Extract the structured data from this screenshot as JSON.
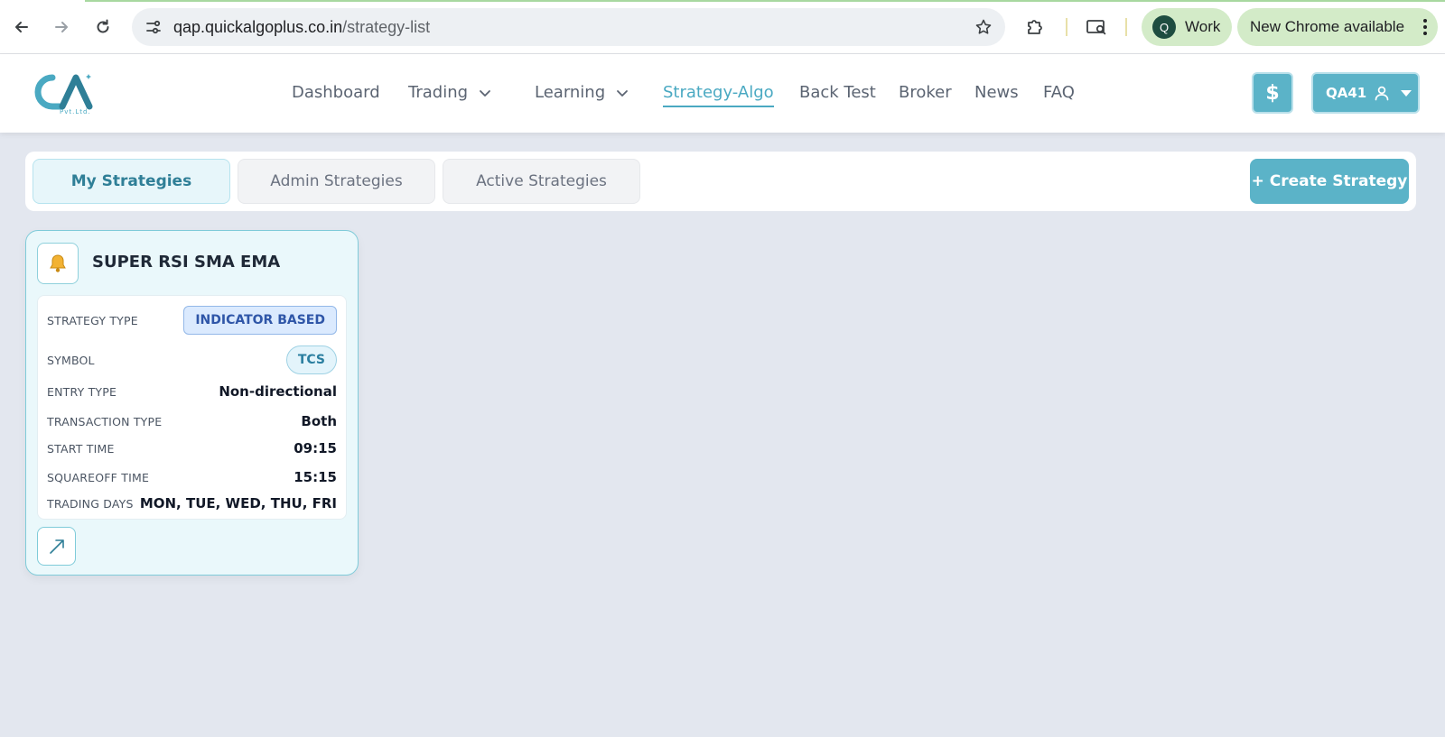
{
  "browser": {
    "url_domain": "qap.quickalgoplus.co.in",
    "url_path": "/strategy-list",
    "profile_initial": "Q",
    "profile_name": "Work",
    "update_label": "New Chrome available"
  },
  "header": {
    "logo_text": "QA",
    "logo_sub": "Pvt.Ltd.",
    "nav": {
      "dashboard": "Dashboard",
      "trading": "Trading",
      "learning": "Learning",
      "strategy_algo": "Strategy-Algo",
      "back_test": "Back Test",
      "broker": "Broker",
      "news": "News",
      "faq": "FAQ"
    },
    "active_nav": "Strategy-Algo",
    "wallet_icon": "$",
    "user_label": "QA41"
  },
  "tabs": {
    "my": "My Strategies",
    "admin": "Admin Strategies",
    "active": "Active Strategies",
    "selected": "My Strategies",
    "create_label": "+ Create Strategy"
  },
  "strategy": {
    "name": "SUPER RSI SMA EMA",
    "icon": "bell-icon",
    "rows": {
      "strategy_type": {
        "label": "STRATEGY TYPE",
        "value": "INDICATOR BASED"
      },
      "symbol": {
        "label": "SYMBOL",
        "value": "TCS"
      },
      "entry_type": {
        "label": "ENTRY TYPE",
        "value": "Non-directional"
      },
      "transaction_type": {
        "label": "TRANSACTION TYPE",
        "value": "Both"
      },
      "start_time": {
        "label": "START TIME",
        "value": "09:15"
      },
      "squareoff_time": {
        "label": "SQUAREOFF TIME",
        "value": "15:15"
      },
      "trading_days": {
        "label": "TRADING DAYS",
        "value": "MON, TUE, WED, THU, FRI"
      }
    }
  },
  "colors": {
    "accent": "#5bb3c8",
    "page_bg": "#e3e7ef",
    "card_bg": "#eaf8fb",
    "active_nav": "#4aa9c2"
  }
}
